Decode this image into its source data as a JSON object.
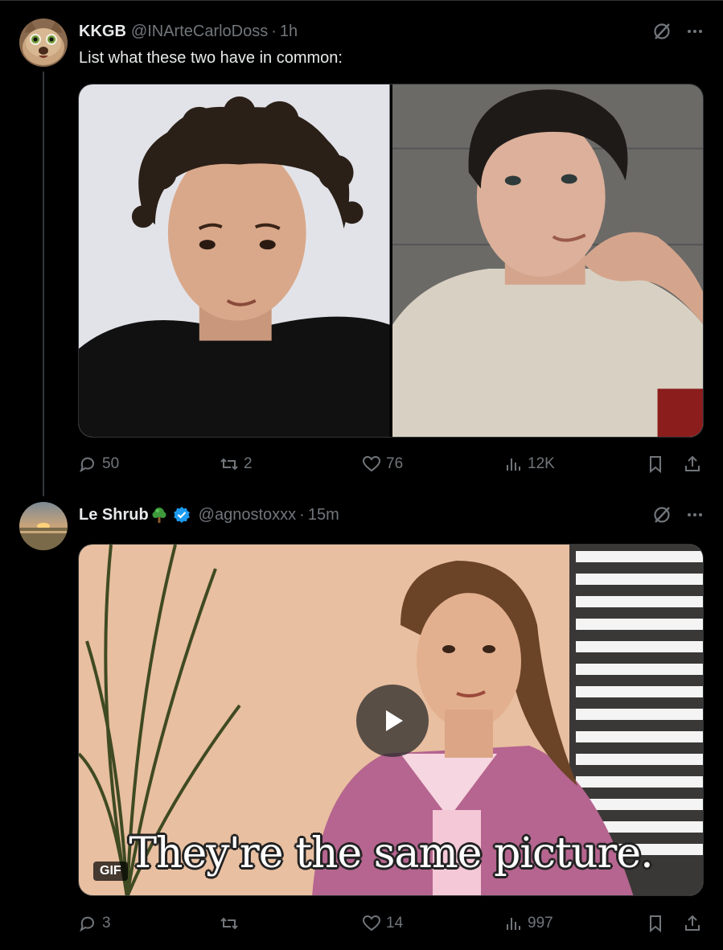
{
  "tweets": [
    {
      "name": "KKGB",
      "handle": "@INArteCarloDoss",
      "dot": "·",
      "time": "1h",
      "text": "List what these two have in common:",
      "stats": {
        "replies": "50",
        "reposts": "2",
        "likes": "76",
        "views": "12K"
      }
    },
    {
      "name": "Le Shrub",
      "handle": "@agnostoxxx",
      "dot": "·",
      "time": "15m",
      "media": {
        "badge": "GIF",
        "caption": "They're the same picture."
      },
      "stats": {
        "replies": "3",
        "reposts": "",
        "likes": "14",
        "views": "997"
      }
    }
  ],
  "icons": [
    "reply-icon",
    "repost-icon",
    "like-icon",
    "views-icon",
    "bookmark-icon",
    "share-icon",
    "grok-icon",
    "more-icon",
    "verified-badge-icon",
    "tree-emoji-icon",
    "play-icon"
  ],
  "colors": {
    "background": "#000000",
    "text": "#e7e9ea",
    "muted": "#71767b",
    "verified": "#1d9bf0",
    "border": "#2f3336"
  }
}
